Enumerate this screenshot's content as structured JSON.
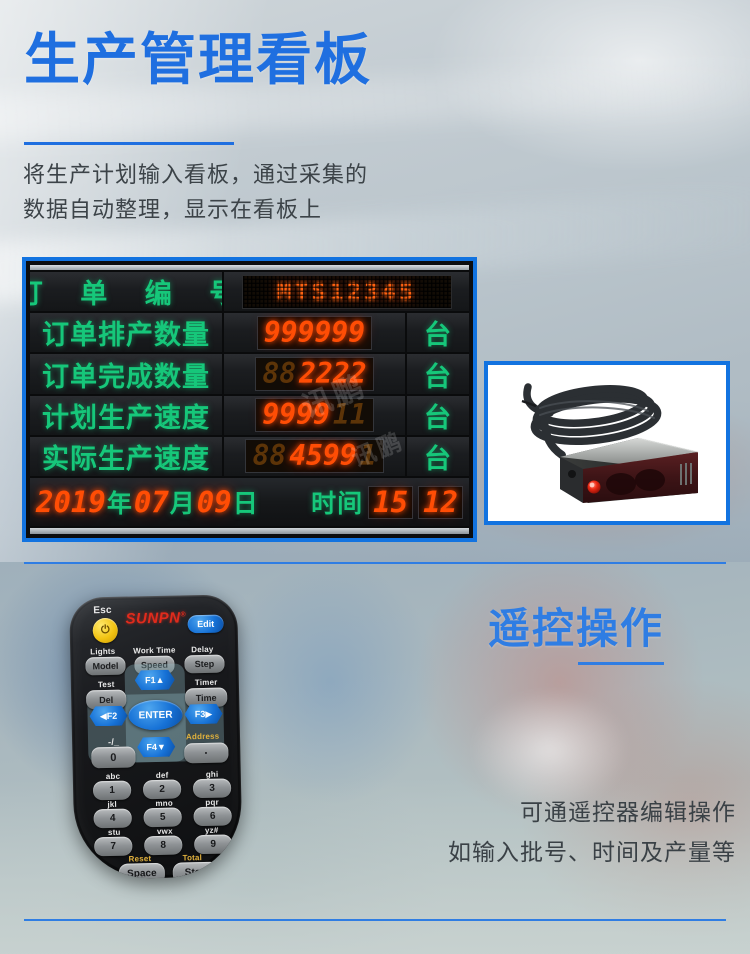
{
  "header": {
    "title": "生产管理看板",
    "subtitle_line1": "将生产计划输入看板，通过采集的",
    "subtitle_line2": "数据自动整理，显示在看板上",
    "accent_color": "#1f6fe0"
  },
  "board": {
    "border_color": "#1273e0",
    "label_color": "#16c77a",
    "digit_color": "#ff4d05",
    "rows": [
      {
        "label": "订 单 编 号",
        "value": "MTS12345",
        "unit": "",
        "type": "dotmatrix"
      },
      {
        "label": "订单排产数量",
        "value": "999999",
        "dim_prefix": "",
        "unit": "台",
        "type": "seg"
      },
      {
        "label": "订单完成数量",
        "value": "2222",
        "dim_prefix": "88",
        "unit": "台",
        "type": "seg"
      },
      {
        "label": "计划生产速度",
        "value": "9999",
        "dim_prefix": "",
        "dim_suffix": "11",
        "unit": "台",
        "type": "seg"
      },
      {
        "label": "实际生产速度",
        "value": "4599",
        "dim_prefix": "88",
        "dim_suffix": "1",
        "unit": "台",
        "type": "seg"
      }
    ],
    "datebar": {
      "year": "2019",
      "year_unit": "年",
      "month": "07",
      "month_unit": "月",
      "day": "09",
      "day_unit": "日",
      "time_label": "时间",
      "hour": "15",
      "minute": "12"
    },
    "watermark": "讯鹏"
  },
  "sensor_card": {
    "border_color": "#1273e0",
    "alt": "photoelectric-sensor-with-cable"
  },
  "section2": {
    "title": "遥控操作",
    "body_line1": "可通遥控器编辑操作",
    "body_line2": "如输入批号、时间及产量等",
    "accent_color": "#2f7de3"
  },
  "remote": {
    "brand": "SUNPN",
    "brand_mark": "®",
    "captions": {
      "esc": "Esc",
      "lights": "Lights",
      "work_time": "Work Time",
      "delay": "Delay",
      "test": "Test",
      "timer": "Timer",
      "minus": "-/_",
      "address": "Address",
      "reset": "Reset",
      "total": "Total"
    },
    "buttons": {
      "power": "⏻",
      "edit": "Edit",
      "model": "Model",
      "speed": "Speed",
      "step": "Step",
      "del": "Del",
      "time": "Time",
      "f1": "F1▲",
      "f2": "◀F2",
      "enter": "ENTER",
      "f3": "F3▶",
      "f4": "F4▼",
      "zero": "0",
      "dot": "·",
      "space": "Space",
      "stop": "Stop"
    },
    "keypad": [
      {
        "letters": "abc",
        "digit": "1"
      },
      {
        "letters": "def",
        "digit": "2"
      },
      {
        "letters": "ghi",
        "digit": "3"
      },
      {
        "letters": "jkl",
        "digit": "4"
      },
      {
        "letters": "mno",
        "digit": "5"
      },
      {
        "letters": "pqr",
        "digit": "6"
      },
      {
        "letters": "stu",
        "digit": "7"
      },
      {
        "letters": "vwx",
        "digit": "8"
      },
      {
        "letters": "yz#",
        "digit": "9"
      }
    ]
  }
}
